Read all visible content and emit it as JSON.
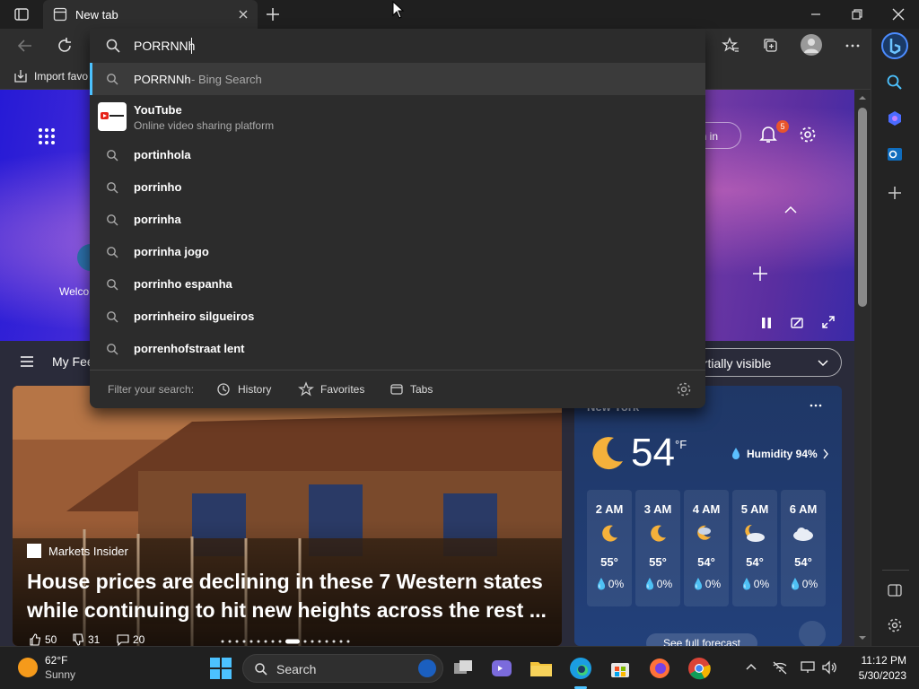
{
  "tab": {
    "title": "New tab"
  },
  "address": {
    "value": "PORRNNh"
  },
  "favbar": {
    "import_label": "Import favo"
  },
  "suggestions": {
    "top": {
      "query": "PORRNNh",
      "suffix": " - Bing Search"
    },
    "site": {
      "title": "YouTube",
      "subtitle": "Online video sharing platform"
    },
    "items": [
      "portinhola",
      "porrinho",
      "porrinha",
      "porrinha jogo",
      "porrinho espanha",
      "porrinheiro silgueiros",
      "porrenhofstraat lent"
    ]
  },
  "filter": {
    "label": "Filter your search:",
    "history": "History",
    "favorites": "Favorites",
    "tabs": "Tabs"
  },
  "page": {
    "welcome": "Welco",
    "signin": "gn in",
    "notification_count": "5",
    "feed_label": "My Fee",
    "visibility": "artially visible",
    "card": {
      "source": "Markets Insider",
      "headline": "House prices are declining in these 7 Western states while continuing to hit new heights across the rest ...",
      "likes": "50",
      "dislikes": "31",
      "comments": "20"
    },
    "weather": {
      "city": "New York",
      "temp": "54",
      "unit": "°F",
      "humidity": "Humidity 94%",
      "hours": [
        {
          "time": "2 AM",
          "temp": "55°",
          "precip": "0%",
          "icon": "moon-icon"
        },
        {
          "time": "3 AM",
          "temp": "55°",
          "precip": "0%",
          "icon": "moon-icon"
        },
        {
          "time": "4 AM",
          "temp": "54°",
          "precip": "0%",
          "icon": "moon-cloud-icon"
        },
        {
          "time": "5 AM",
          "temp": "54°",
          "precip": "0%",
          "icon": "moon-cloud-icon"
        },
        {
          "time": "6 AM",
          "temp": "54°",
          "precip": "0%",
          "icon": "cloud-icon"
        }
      ],
      "forecast_link": "See full forecast"
    }
  },
  "taskbar": {
    "weather_temp": "62°F",
    "weather_cond": "Sunny",
    "search": "Search",
    "time": "11:12 PM",
    "date": "5/30/2023"
  },
  "colors": {
    "accent": "#4cc2ff",
    "badge": "#e8542c",
    "dropdown": "#2c2c2c"
  }
}
